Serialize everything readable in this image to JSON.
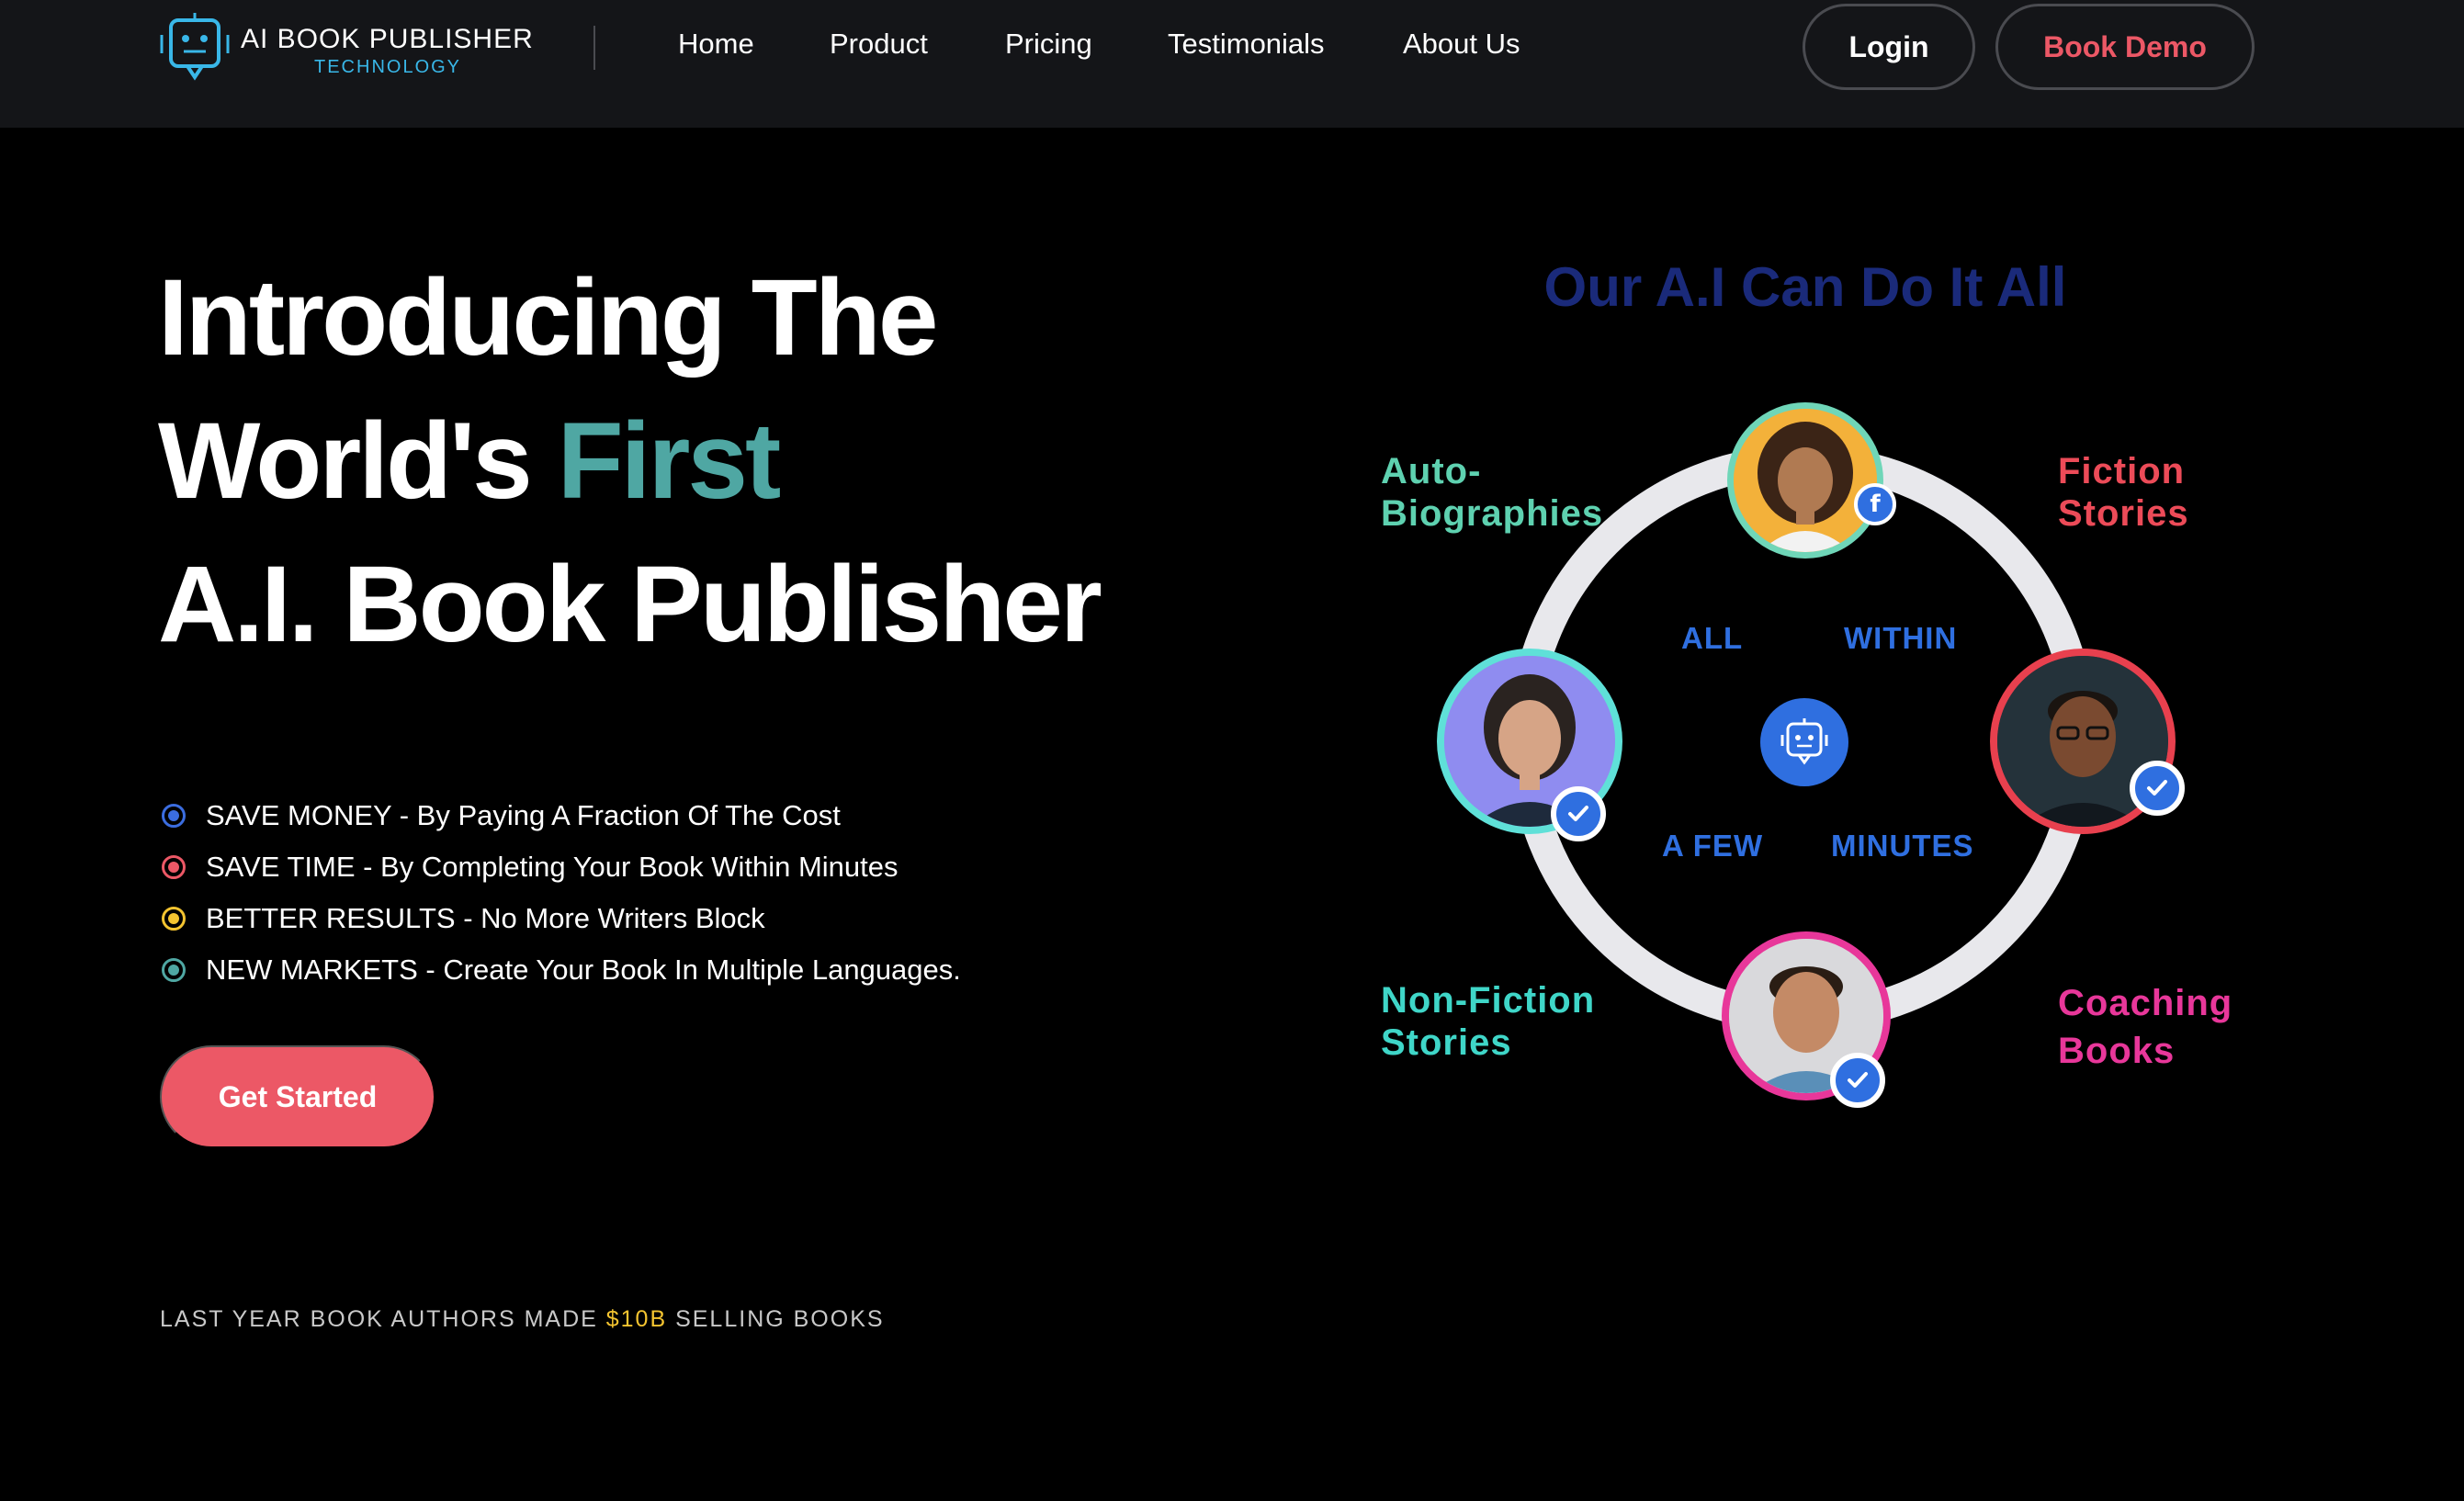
{
  "header": {
    "logo_title": "AI BOOK PUBLISHER",
    "logo_subtitle": "TECHNOLOGY",
    "nav": [
      {
        "label": "Home"
      },
      {
        "label": "Product"
      },
      {
        "label": "Pricing"
      },
      {
        "label": "Testimonials"
      },
      {
        "label": "About Us"
      }
    ],
    "login_label": "Login",
    "demo_label": "Book Demo"
  },
  "hero": {
    "title_line1": "Introducing The",
    "title_line2_prefix": "World's ",
    "title_line2_accent": "First",
    "title_line3": "A.I. Book Publisher",
    "bullets": [
      {
        "text": "SAVE MONEY - By Paying A Fraction Of The Cost",
        "color": "#3b6de0"
      },
      {
        "text": "SAVE TIME - By Completing Your Book Within Minutes",
        "color": "#ec5866"
      },
      {
        "text": "BETTER RESULTS - No More Writers Block",
        "color": "#f4c430"
      },
      {
        "text": "NEW MARKETS - Create Your Book In Multiple Languages.",
        "color": "#4fa7a3"
      }
    ],
    "cta_label": "Get Started",
    "stat_prefix": "LAST YEAR BOOK AUTHORS MADE ",
    "stat_highlight": "$10B",
    "stat_suffix": " SELLING BOOKS"
  },
  "graphic": {
    "heading": "Our A.I Can Do It All",
    "categories": {
      "autobio_line1": "Auto-",
      "autobio_line2": "Biographies",
      "fiction_line1": "Fiction",
      "fiction_line2": "Stories",
      "nonfiction_line1": "Non-Fiction",
      "nonfiction_line2": "Stories",
      "coaching_line1": "Coaching",
      "coaching_line2": "Books"
    },
    "inner_words": {
      "all": "ALL",
      "within": "WITHIN",
      "a_few": "A FEW",
      "minutes": "MINUTES"
    }
  },
  "colors": {
    "accent_teal": "#4fa7a3",
    "brand_red": "#ec5866",
    "brand_blue": "#2f6fe0",
    "gold": "#f4c430",
    "header_bg": "#141518"
  },
  "icons": [
    "robot-logo-icon",
    "robot-center-icon",
    "facebook-icon",
    "check-icon"
  ]
}
